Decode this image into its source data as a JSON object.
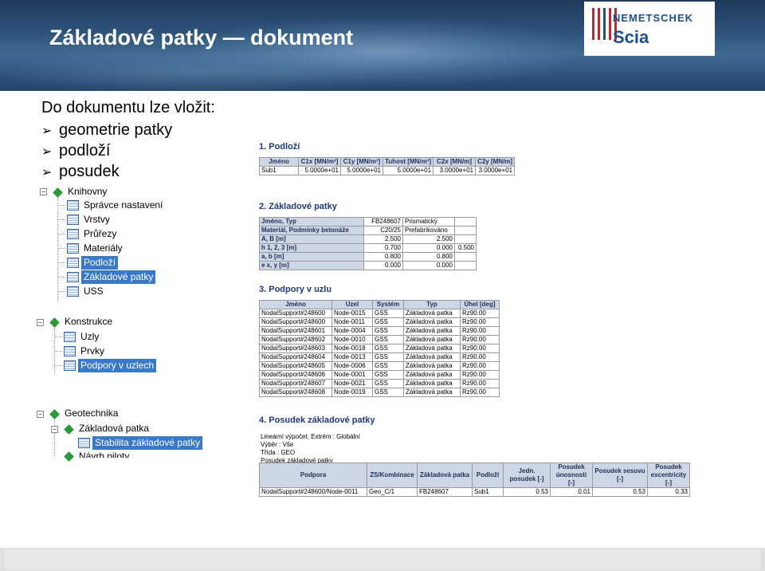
{
  "header": {
    "title": "Základové patky — dokument"
  },
  "logo": {
    "name": "NEMETSCHEK",
    "product": "Scia"
  },
  "intro": "Do dokumentu lze vložit:",
  "bullets": [
    "geometrie patky",
    "podloží",
    "posudek"
  ],
  "tree1": {
    "root": "Knihovny",
    "items": [
      "Správce nastavení",
      "Vrstvy",
      "Průřezy",
      "Materiály",
      "Podloží",
      "Základové patky",
      "USS"
    ],
    "selected": [
      "Podloží",
      "Základové patky"
    ]
  },
  "tree2": {
    "root": "Konstrukce",
    "items": [
      "Uzly",
      "Prvky",
      "Podpory v uzlech"
    ],
    "selected": "Podpory v uzlech"
  },
  "tree3": {
    "root": "Geotechnika",
    "child": "Základová patka",
    "leaf": "Stabilita základové patky",
    "next": "Návrh piloty"
  },
  "doc": {
    "s1": {
      "title": "1. Podloží",
      "headers": [
        "Jméno",
        "C1x [MN/m³]",
        "C1y [MN/m³]",
        "Tuhost [MN/m³]",
        "C2x [MN/m]",
        "C2y [MN/m]"
      ],
      "row": [
        "Sub1",
        "5.0000e+01",
        "5.0000e+01",
        "5.0000e+01",
        "3.0000e+01",
        "3.0000e+01"
      ]
    },
    "s2": {
      "title": "2. Základové patky",
      "rows": [
        [
          "Jméno, Typ",
          "FB248607",
          "Prismatický",
          ""
        ],
        [
          "Materiál, Podmínky betonáže",
          "C20/25",
          "Prefabrikováno",
          ""
        ],
        [
          "A, B [m]",
          "2.500",
          "2.500",
          ""
        ],
        [
          "h 1, 2, 3 [m]",
          "0.700",
          "0.000",
          "0.500"
        ],
        [
          "a, b [m]",
          "0.800",
          "0.800",
          ""
        ],
        [
          "e x, y [m]",
          "0.000",
          "0.000",
          ""
        ]
      ]
    },
    "s3": {
      "title": "3. Podpory v uzlu",
      "headers": [
        "Jméno",
        "Uzel",
        "Systém",
        "Typ",
        "Úhel [deg]"
      ],
      "rows": [
        [
          "NodalSupport#248600",
          "Node-0015",
          "GSS",
          "Základová patka",
          "Rz90.00"
        ],
        [
          "NodalSupport#248600",
          "Node-0011",
          "GSS",
          "Základová patka",
          "Rz90.00"
        ],
        [
          "NodalSupport#248601",
          "Node-0004",
          "GSS",
          "Základová patka",
          "Rz90.00"
        ],
        [
          "NodalSupport#248602",
          "Node-0010",
          "GSS",
          "Základová patka",
          "Rz90.00"
        ],
        [
          "NodalSupport#248603",
          "Node-0018",
          "GSS",
          "Základová patka",
          "Rz90.00"
        ],
        [
          "NodalSupport#248604",
          "Node-0013",
          "GSS",
          "Základová patka",
          "Rz90.00"
        ],
        [
          "NodalSupport#248605",
          "Node-0006",
          "GSS",
          "Základová patka",
          "Rz90.00"
        ],
        [
          "NodalSupport#248606",
          "Node-0001",
          "GSS",
          "Základová patka",
          "Rz90.00"
        ],
        [
          "NodalSupport#248607",
          "Node-0021",
          "GSS",
          "Základová patka",
          "Rz90.00"
        ],
        [
          "NodalSupport#248608",
          "Node-0019",
          "GSS",
          "Základová patka",
          "Rz90.00"
        ]
      ]
    },
    "s4": {
      "title": "4. Posudek základové patky",
      "notes": [
        "Lineární výpočet, Extrém : Globální",
        "Výběr : Vše",
        "Třída : GEO",
        "Posudek základové patky"
      ],
      "headers": [
        "Podpora",
        "ZS/Kombinace",
        "Základová patka",
        "Podloží",
        "Jedn. posudek [-]",
        "Posudek únosnosti [-]",
        "Posudek sesuvu [-]",
        "Posudek excentricity [-]"
      ],
      "row": [
        "NodalSupport#248600/Node-0011",
        "Geo_C/1",
        "FB248607",
        "Sub1",
        "0.53",
        "0.01",
        "0.53",
        "0.33"
      ]
    }
  }
}
